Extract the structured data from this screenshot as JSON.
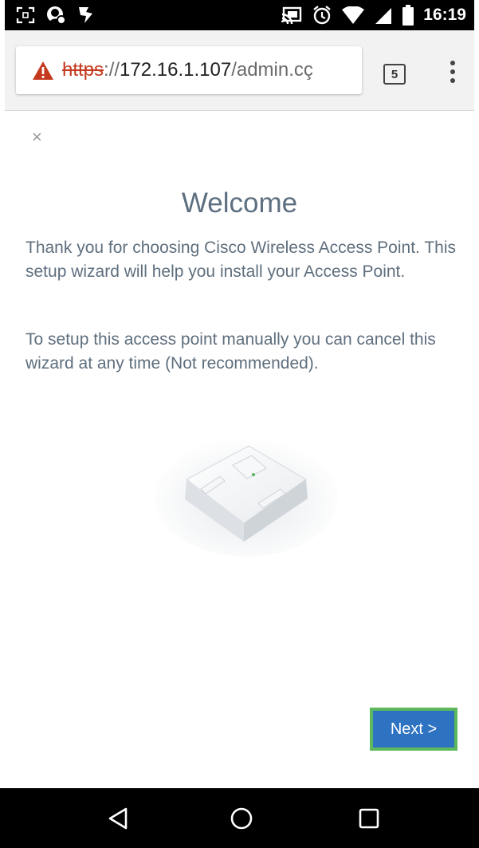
{
  "status_bar": {
    "time": "16:19",
    "icons": [
      "screenshot-icon",
      "app-notification-icon",
      "app-notification-icon",
      "cast-icon",
      "alarm-icon",
      "wifi-icon",
      "signal-icon",
      "battery-icon"
    ]
  },
  "browser": {
    "url_scheme": "https",
    "url_separator": "://",
    "url_host": "172.16.1.107",
    "url_path": "/admin.cç",
    "tab_count": "5",
    "warning_color": "#c5391f"
  },
  "wizard": {
    "close_label": "×",
    "title": "Welcome",
    "paragraph1": "Thank you for choosing Cisco Wireless Access Point. This setup wizard will help you install your Access Point.",
    "paragraph2": "To setup this access point manually you can cancel this wizard at any time (Not recommended).",
    "next_label": "Next >",
    "accent_color": "#2e72c2",
    "highlight_color": "#5cb85c"
  },
  "nav_bar": {
    "icons": [
      "back-icon",
      "home-icon",
      "recents-icon"
    ]
  }
}
